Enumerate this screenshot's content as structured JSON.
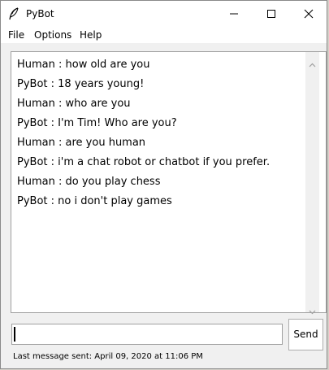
{
  "window": {
    "title": "PyBot"
  },
  "menu": {
    "items": [
      {
        "label": "File"
      },
      {
        "label": "Options"
      },
      {
        "label": "Help"
      }
    ]
  },
  "chat": {
    "messages": [
      {
        "text": "Human : how old are you"
      },
      {
        "text": "PyBot : 18 years young!"
      },
      {
        "text": "Human : who are you"
      },
      {
        "text": "PyBot : I'm Tim! Who are you?"
      },
      {
        "text": "Human : are you human"
      },
      {
        "text": "PyBot : i'm a chat robot or chatbot if you prefer."
      },
      {
        "text": "Human : do you play chess"
      },
      {
        "text": "PyBot : no i don't play games"
      }
    ]
  },
  "input": {
    "value": ""
  },
  "send_button": {
    "label": "Send"
  },
  "status": {
    "text": "Last message sent: April 09, 2020 at 11:06 PM"
  },
  "icons": {
    "app": "feather-icon",
    "minimize": "minimize-icon",
    "maximize": "maximize-icon",
    "close": "close-icon",
    "scroll_up": "chevron-up-icon",
    "scroll_down": "chevron-down-icon"
  }
}
